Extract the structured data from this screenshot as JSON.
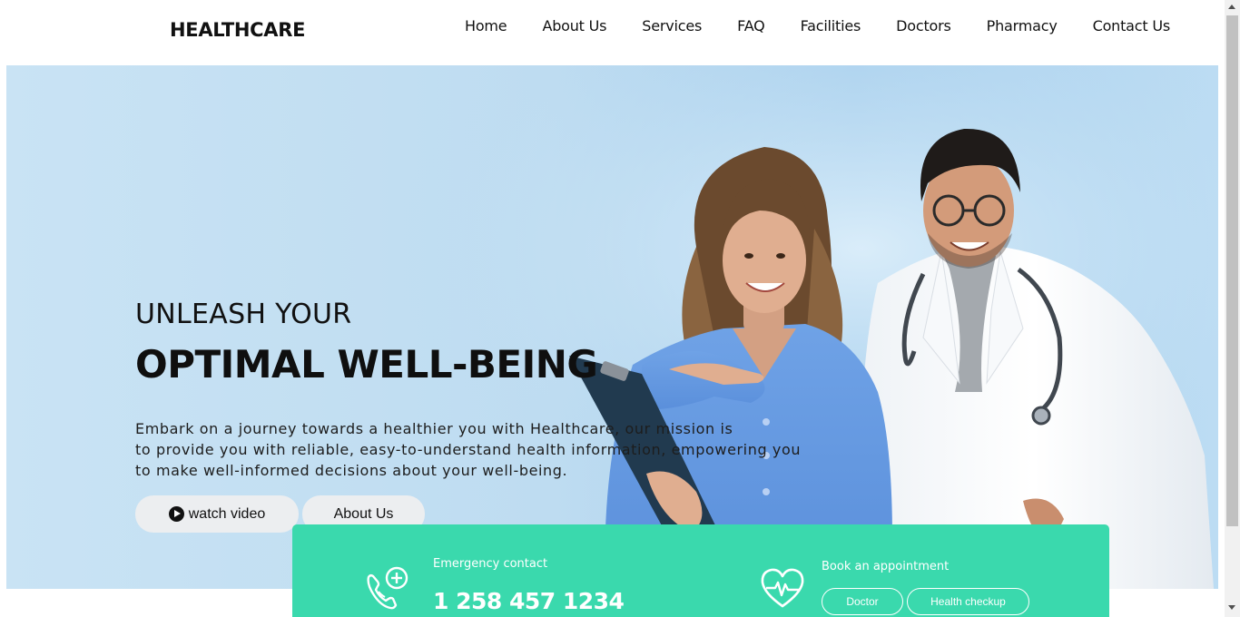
{
  "brand": {
    "logo": "HEALTHCARE"
  },
  "nav": [
    {
      "label": "Home"
    },
    {
      "label": "About Us"
    },
    {
      "label": "Services"
    },
    {
      "label": "FAQ"
    },
    {
      "label": "Facilities"
    },
    {
      "label": "Doctors"
    },
    {
      "label": "Pharmacy"
    },
    {
      "label": "Contact Us"
    }
  ],
  "hero": {
    "kicker": "UNLEASH YOUR",
    "headline": "OPTIMAL WELL-BEING",
    "description_lines": [
      "Embark on a journey towards a healthier you with Healthcare, our mission is",
      "to provide you with reliable, easy-to-understand health information, empowering you",
      "to make well-informed decisions about your well-being."
    ],
    "watch_video_label": "watch video",
    "about_label": "About Us",
    "image": "smiling-nurse-and-doctor-photo"
  },
  "contact_panel": {
    "emergency_label": "Emergency contact",
    "emergency_phone": "1 258 457 1234",
    "appointment_label": "Book an appointment",
    "doctor_label": "Doctor",
    "checkup_label": "Health checkup",
    "phone_icon": "phone-plus-icon",
    "heart_icon": "heartbeat-icon"
  },
  "colors": {
    "accent_green": "#3ad9ad",
    "hero_bg": "#bedcf1",
    "button_bg": "#eceef0"
  }
}
